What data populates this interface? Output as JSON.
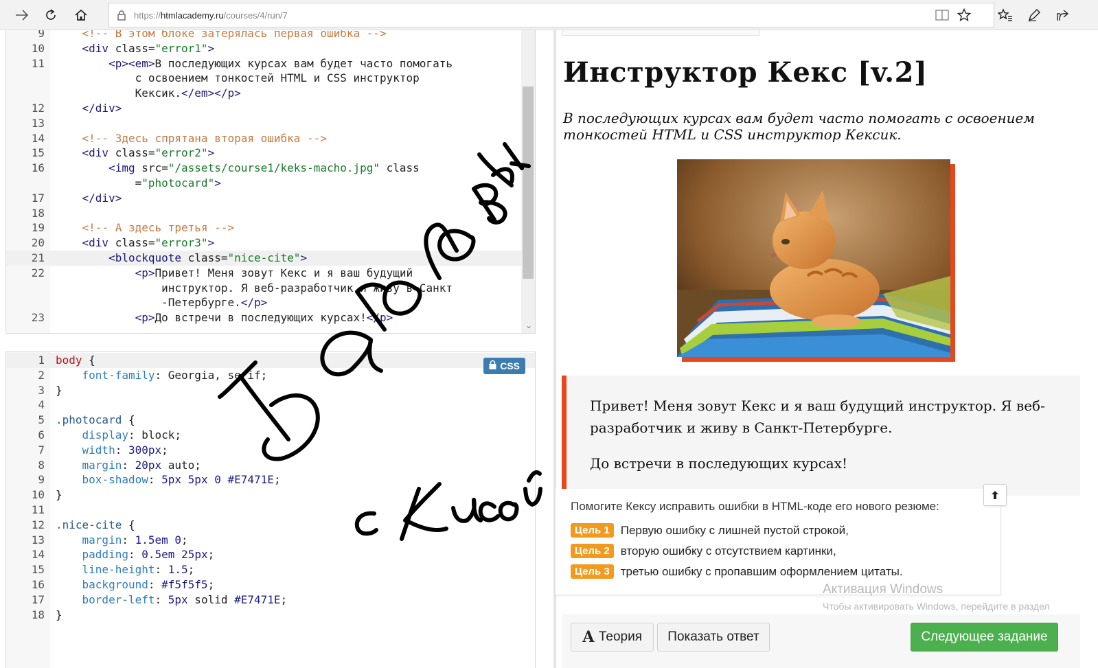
{
  "browser": {
    "url_proto": "https://",
    "url_host": "htmlacademy.ru",
    "url_path": "/courses/4/run/7",
    "icons": [
      "back-arrow-icon",
      "refresh-icon",
      "home-icon",
      "lock-icon",
      "reading-view-icon",
      "favorite-star-icon",
      "favorites-icon",
      "pen-icon",
      "share-icon"
    ]
  },
  "html_editor": {
    "active_line": "21",
    "lines": [
      {
        "n": "9",
        "text": "    <!-- В этом блоке затерялась первая ошибка -->"
      },
      {
        "n": "10",
        "text": "    <div class=\"error1\">"
      },
      {
        "n": "11",
        "text": "        <p><em>В последующих курсах вам будет часто помогать"
      },
      {
        "n": "",
        "text": "            с освоением тонкостей HTML и CSS инструктор"
      },
      {
        "n": "",
        "text": "            Кексик.</em></p>"
      },
      {
        "n": "12",
        "text": "    </div>"
      },
      {
        "n": "13",
        "text": ""
      },
      {
        "n": "14",
        "text": "    <!-- Здесь спрятана вторая ошибка -->"
      },
      {
        "n": "15",
        "text": "    <div class=\"error2\">"
      },
      {
        "n": "16",
        "text": "        <img src=\"/assets/course1/keks-macho.jpg\" class"
      },
      {
        "n": "",
        "text": "            =\"photocard\">"
      },
      {
        "n": "17",
        "text": "    </div>"
      },
      {
        "n": "18",
        "text": ""
      },
      {
        "n": "19",
        "text": "    <!-- А здесь третья -->"
      },
      {
        "n": "20",
        "text": "    <div class=\"error3\">"
      },
      {
        "n": "21",
        "text": "        <blockquote class=\"nice-cite\">"
      },
      {
        "n": "22",
        "text": "            <p>Привет! Меня зовут Кекс и я ваш будущий"
      },
      {
        "n": "",
        "text": "                инструктор. Я веб-разработчик и живу в Санкт"
      },
      {
        "n": "",
        "text": "                -Петербурге.</p>"
      },
      {
        "n": "23",
        "text": "            <p>До встречи в последующих курсах!</p>"
      }
    ]
  },
  "css_editor": {
    "badge": "CSS",
    "active_line": "1",
    "lines": [
      {
        "n": "1",
        "text": "body {"
      },
      {
        "n": "2",
        "text": "    font-family: Georgia, serif;"
      },
      {
        "n": "3",
        "text": "}"
      },
      {
        "n": "4",
        "text": ""
      },
      {
        "n": "5",
        "text": ".photocard {"
      },
      {
        "n": "6",
        "text": "    display: block;"
      },
      {
        "n": "7",
        "text": "    width: 300px;"
      },
      {
        "n": "8",
        "text": "    margin: 20px auto;"
      },
      {
        "n": "9",
        "text": "    box-shadow: 5px 5px 0 #E7471E;"
      },
      {
        "n": "10",
        "text": "}"
      },
      {
        "n": "11",
        "text": ""
      },
      {
        "n": "12",
        "text": ".nice-cite {"
      },
      {
        "n": "13",
        "text": "    margin: 1.5em 0;"
      },
      {
        "n": "14",
        "text": "    padding: 0.5em 25px;"
      },
      {
        "n": "15",
        "text": "    line-height: 1.5;"
      },
      {
        "n": "16",
        "text": "    background: #f5f5f5;"
      },
      {
        "n": "17",
        "text": "    border-left: 5px solid #E7471E;"
      },
      {
        "n": "18",
        "text": "}"
      }
    ]
  },
  "preview": {
    "title": "Инструктор Кекс [v.2]",
    "lead": "В последующих курсах вам будет часто помогать с освоением тонкостей HTML и CSS инструктор Кексик.",
    "cite_p1": "Привет! Меня зовут Кекс и я ваш будущий инструктор. Я веб-разработчик и живу в Санкт-Петербурге.",
    "cite_p2": "До встречи в последующих курсах!",
    "accent_color": "#E7471E"
  },
  "task": {
    "intro": "Помогите Кексу исправить ошибки в HTML-коде его нового резюме:",
    "goals": [
      {
        "tag": "Цель 1",
        "text": "Первую ошибку с лишней пустой строкой,"
      },
      {
        "tag": "Цель 2",
        "text": "вторую ошибку с отсутствием картинки,"
      },
      {
        "tag": "Цель 3",
        "text": "третью ошибку с пропавшим оформлением цитаты."
      }
    ]
  },
  "buttons": {
    "theory_icon": "А",
    "theory": "Теория",
    "show_answer": "Показать ответ",
    "next": "Следующее задание"
  },
  "watermark": {
    "title": "Активация Windows",
    "text": "Чтобы активировать Windows, перейдите в раздел \"Параметры\"."
  },
  "handwriting": {
    "line1": "Баголовы",
    "line2": "с Кисой"
  }
}
